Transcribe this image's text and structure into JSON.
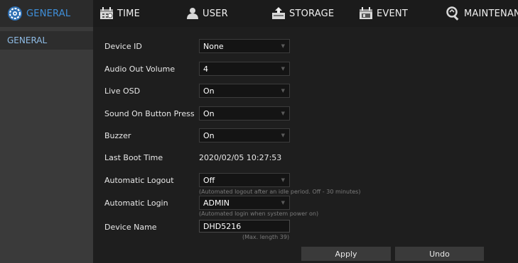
{
  "nav": {
    "tabs": [
      {
        "label": "GENERAL",
        "icon": "gear-icon",
        "active": true
      },
      {
        "label": "TIME",
        "icon": "calendar-icon"
      },
      {
        "label": "USER",
        "icon": "user-icon"
      },
      {
        "label": "STORAGE",
        "icon": "storage-icon"
      },
      {
        "label": "EVENT",
        "icon": "event-icon"
      },
      {
        "label": "MAINTENANCE",
        "icon": "maintenance-icon"
      }
    ]
  },
  "sidebar": {
    "items": [
      {
        "label": "GENERAL"
      }
    ]
  },
  "form": {
    "device_id": {
      "label": "Device ID",
      "value": "None"
    },
    "audio_out_volume": {
      "label": "Audio Out Volume",
      "value": "4"
    },
    "live_osd": {
      "label": "Live OSD",
      "value": "On"
    },
    "sound_on_button_press": {
      "label": "Sound On Button Press",
      "value": "On"
    },
    "buzzer": {
      "label": "Buzzer",
      "value": "On"
    },
    "last_boot_time": {
      "label": "Last Boot Time",
      "value": "2020/02/05 10:27:53"
    },
    "automatic_logout": {
      "label": "Automatic Logout",
      "value": "Off",
      "hint": "(Automated logout after an idle period. Off - 30 minutes)"
    },
    "automatic_login": {
      "label": "Automatic Login",
      "value": "ADMIN",
      "hint": "(Automated login when system power on)"
    },
    "device_name": {
      "label": "Device Name",
      "value": "DHD5216",
      "hint": "(Max. length 39)"
    }
  },
  "actions": {
    "apply": "Apply",
    "undo": "Undo"
  },
  "colors": {
    "accent": "#3f8fd9",
    "background": "#1e1e1e",
    "sidebar": "#3a3a3a",
    "field": "#141414"
  }
}
